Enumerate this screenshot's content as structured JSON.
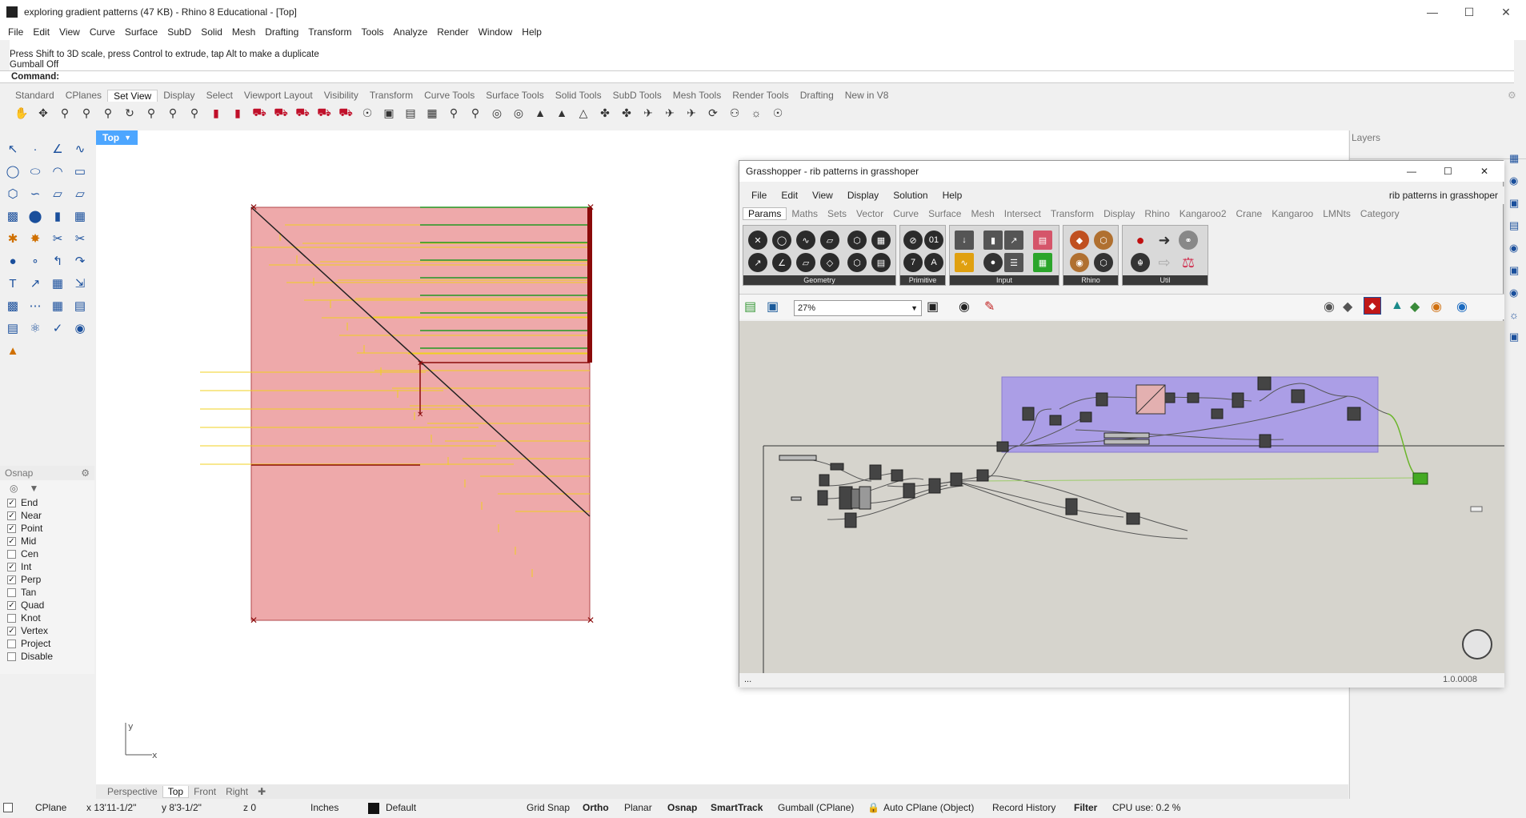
{
  "window": {
    "title": "exploring gradient patterns (47 KB) - Rhino 8 Educational - [Top]"
  },
  "menu": [
    "File",
    "Edit",
    "View",
    "Curve",
    "Surface",
    "SubD",
    "Solid",
    "Mesh",
    "Drafting",
    "Transform",
    "Tools",
    "Analyze",
    "Render",
    "Window",
    "Help"
  ],
  "command_history": [
    "Press Shift to 3D scale, press Control to extrude, tap Alt to make a duplicate",
    "Gumball Off"
  ],
  "command_prompt": "Command:",
  "toolbar_tabs": [
    "Standard",
    "CPlanes",
    "Set View",
    "Display",
    "Select",
    "Viewport Layout",
    "Visibility",
    "Transform",
    "Curve Tools",
    "Surface Tools",
    "Solid Tools",
    "SubD Tools",
    "Mesh Tools",
    "Render Tools",
    "Drafting",
    "New in V8"
  ],
  "toolbar_active_tab": "Set View",
  "viewport": {
    "label": "Top",
    "axis_x": "x",
    "axis_y": "y"
  },
  "viewport_tabs": [
    "Perspective",
    "Top",
    "Front",
    "Right"
  ],
  "osnap": {
    "title": "Osnap",
    "items": [
      {
        "label": "End",
        "checked": true
      },
      {
        "label": "Near",
        "checked": true
      },
      {
        "label": "Point",
        "checked": true
      },
      {
        "label": "Mid",
        "checked": true
      },
      {
        "label": "Cen",
        "checked": false
      },
      {
        "label": "Int",
        "checked": true
      },
      {
        "label": "Perp",
        "checked": true
      },
      {
        "label": "Tan",
        "checked": false
      },
      {
        "label": "Quad",
        "checked": true
      },
      {
        "label": "Knot",
        "checked": false
      },
      {
        "label": "Vertex",
        "checked": true
      },
      {
        "label": "Project",
        "checked": false
      },
      {
        "label": "Disable",
        "checked": false
      }
    ]
  },
  "layers_panel": {
    "title": "Layers"
  },
  "status": {
    "cplane": "CPlane",
    "x": "x 13'11-1/2\"",
    "y": "y 8'3-1/2\"",
    "z": "z 0",
    "units": "Inches",
    "layer": "Default",
    "grid_snap": "Grid Snap",
    "ortho": "Ortho",
    "planar": "Planar",
    "osnap": "Osnap",
    "smarttrack": "SmartTrack",
    "gumball": "Gumball (CPlane)",
    "autocplane": "Auto CPlane (Object)",
    "record_history": "Record History",
    "filter": "Filter",
    "cpu": "CPU use: 0.2 %"
  },
  "grasshopper": {
    "title": "Grasshopper - rib patterns in grasshoper",
    "menu": [
      "File",
      "Edit",
      "View",
      "Display",
      "Solution",
      "Help"
    ],
    "document": "rib patterns in grasshoper",
    "tabs": [
      "Params",
      "Maths",
      "Sets",
      "Vector",
      "Curve",
      "Surface",
      "Mesh",
      "Intersect",
      "Transform",
      "Display",
      "Rhino",
      "Kangaroo2",
      "Crane",
      "Kangaroo",
      "LMNts",
      "Category"
    ],
    "active_tab": "Params",
    "groups": [
      "Geometry",
      "Primitive",
      "Input",
      "Rhino",
      "Util"
    ],
    "zoom": "27%",
    "footer_left": "...",
    "version": "1.0.0008"
  }
}
